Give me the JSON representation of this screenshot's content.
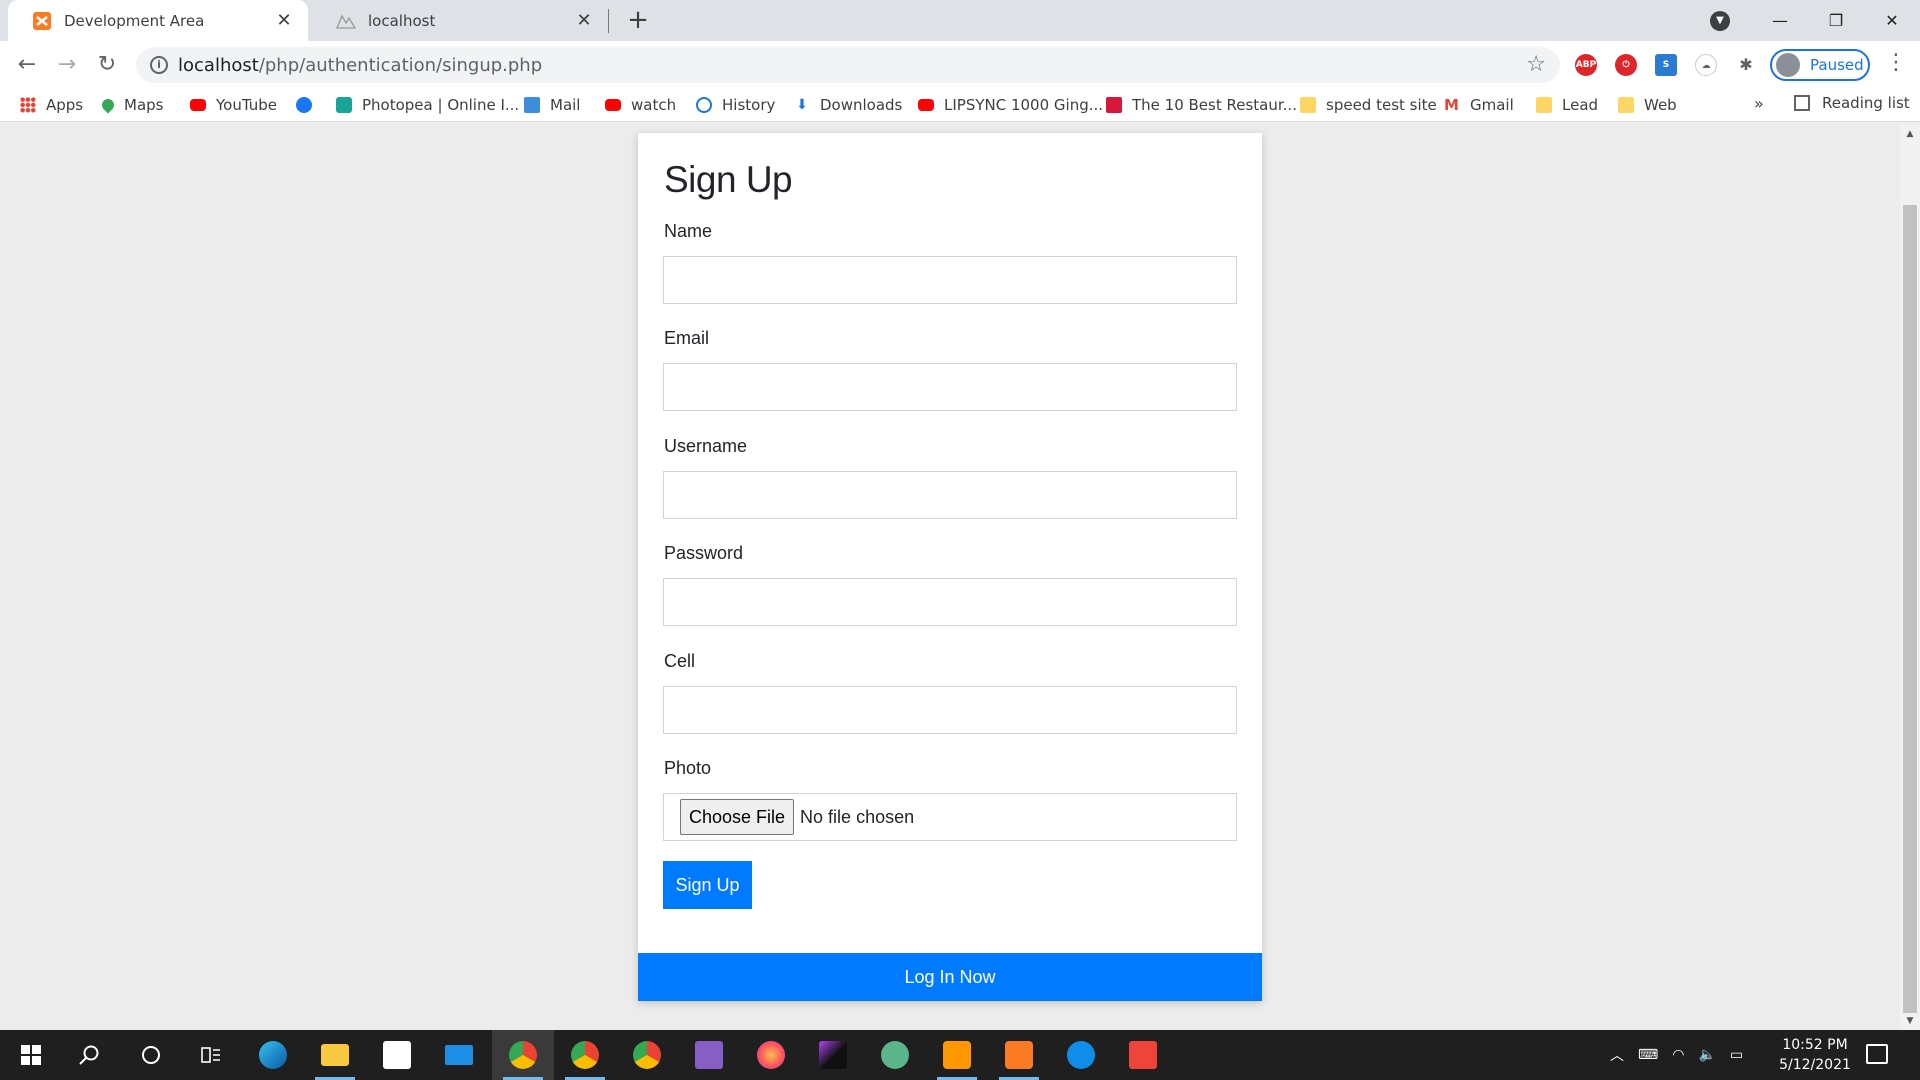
{
  "browser": {
    "tabs": [
      {
        "title": "Development Area",
        "active": true,
        "favicon": "xampp-icon"
      },
      {
        "title": "localhost",
        "active": false,
        "favicon": "phpmyadmin-icon"
      }
    ],
    "url_host": "localhost",
    "url_path": "/php/authentication/singup.php",
    "profile_label": "Paused",
    "bookmarks": [
      {
        "label": "Apps",
        "icon": "apps-grid-icon"
      },
      {
        "label": "Maps",
        "icon": "maps-icon"
      },
      {
        "label": "YouTube",
        "icon": "youtube-icon"
      },
      {
        "label": "",
        "icon": "facebook-icon"
      },
      {
        "label": "Photopea | Online I...",
        "icon": "photopea-icon"
      },
      {
        "label": "Mail",
        "icon": "mail-icon"
      },
      {
        "label": "watch",
        "icon": "youtube-icon"
      },
      {
        "label": "History",
        "icon": "history-icon"
      },
      {
        "label": "Downloads",
        "icon": "download-icon"
      },
      {
        "label": "LIPSYNC 1000 Ging...",
        "icon": "youtube-icon"
      },
      {
        "label": "The 10 Best Restaur...",
        "icon": "restaurant-icon"
      },
      {
        "label": "speed test site",
        "icon": "folder-icon"
      },
      {
        "label": "Gmail",
        "icon": "gmail-icon"
      },
      {
        "label": "Lead",
        "icon": "folder-icon"
      },
      {
        "label": "Web",
        "icon": "folder-icon"
      }
    ],
    "bookmarks_more": "»",
    "reading_list": "Reading list"
  },
  "form": {
    "title": "Sign Up",
    "fields": [
      {
        "label": "Name",
        "value": "",
        "placeholder": ""
      },
      {
        "label": "Email",
        "value": "",
        "placeholder": ""
      },
      {
        "label": "Username",
        "value": "",
        "placeholder": ""
      },
      {
        "label": "Password",
        "value": "",
        "placeholder": ""
      },
      {
        "label": "Cell",
        "value": "",
        "placeholder": ""
      }
    ],
    "photo_label": "Photo",
    "file_button": "Choose File",
    "file_status": "No file chosen",
    "submit_label": "Sign Up",
    "login_label": "Log In Now",
    "accent_color": "#007bff"
  },
  "taskbar": {
    "time": "10:52 PM",
    "date": "5/12/2021"
  }
}
